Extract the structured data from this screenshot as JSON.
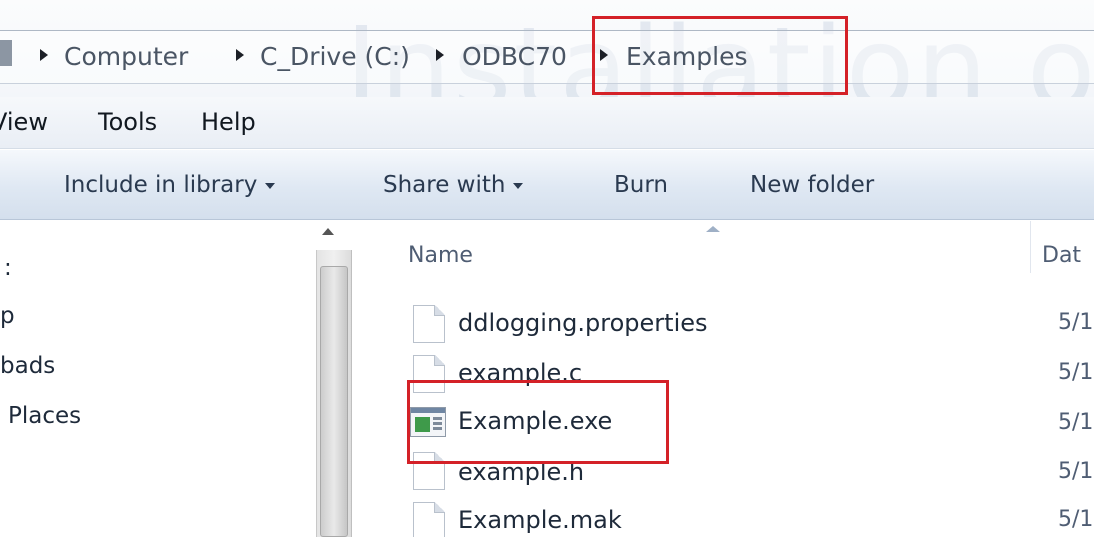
{
  "address_bar": {
    "watermark": "Installation of IE",
    "breadcrumb": [
      "Computer",
      "C_Drive (C:)",
      "ODBC70",
      "Examples"
    ]
  },
  "menu_bar": {
    "items": [
      "View",
      "Tools",
      "Help"
    ]
  },
  "command_bar": {
    "items": [
      "Include in library",
      "Share with",
      "Burn",
      "New folder"
    ]
  },
  "nav_pane": {
    "items": [
      ":",
      "p",
      "bads",
      "Places"
    ]
  },
  "file_list": {
    "columns": {
      "name": "Name",
      "date": "Dat"
    },
    "files": [
      {
        "name": "ddlogging.properties",
        "date": "5/1",
        "icon": "document-icon"
      },
      {
        "name": "example.c",
        "date": "5/1",
        "icon": "document-icon"
      },
      {
        "name": "Example.exe",
        "date": "5/1",
        "icon": "application-icon"
      },
      {
        "name": "example.h",
        "date": "5/1",
        "icon": "document-icon"
      },
      {
        "name": "Example.mak",
        "date": "5/1",
        "icon": "document-icon"
      }
    ]
  },
  "highlight_color": "#d42128"
}
